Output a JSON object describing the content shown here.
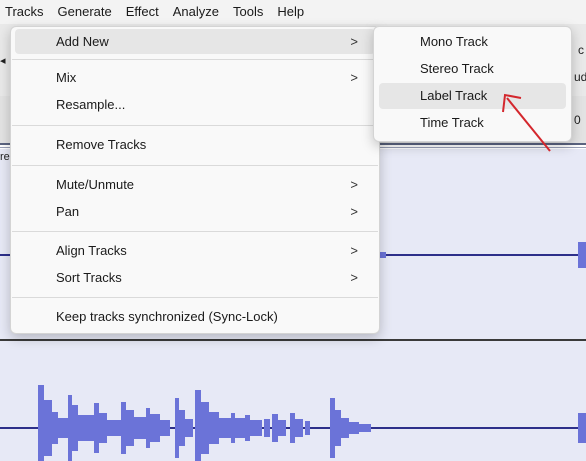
{
  "menubar": {
    "items": [
      "Tracks",
      "Generate",
      "Effect",
      "Analyze",
      "Tools",
      "Help"
    ]
  },
  "tracks_menu": {
    "items": [
      {
        "label": "Add New",
        "arrow": ">"
      },
      {
        "label": "Mix",
        "arrow": ">"
      },
      {
        "label": "Resample...",
        "arrow": ""
      },
      {
        "label": "Remove Tracks",
        "arrow": ""
      },
      {
        "label": "Mute/Unmute",
        "arrow": ">"
      },
      {
        "label": "Pan",
        "arrow": ">"
      },
      {
        "label": "Align Tracks",
        "arrow": ">"
      },
      {
        "label": "Sort Tracks",
        "arrow": ">"
      },
      {
        "label": "Keep tracks synchronized (Sync-Lock)",
        "arrow": ""
      }
    ]
  },
  "add_new_submenu": {
    "items": [
      "Mono Track",
      "Stereo Track",
      "Label Track",
      "Time Track"
    ]
  },
  "background_fragments": {
    "left_arrow": "◂",
    "right_top": "c",
    "right_mid": "ud",
    "right_low": "0",
    "left_re": "re"
  },
  "colors": {
    "waveform": "#6b73d8",
    "annotation_arrow": "#d4272d",
    "highlight": "#e6e6e6"
  }
}
